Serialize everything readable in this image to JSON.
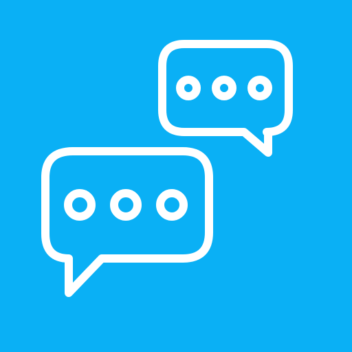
{
  "icon": {
    "name": "chat-bubbles-icon",
    "background_color": "#0AB0F5",
    "stroke_color": "#FFFFFF"
  }
}
